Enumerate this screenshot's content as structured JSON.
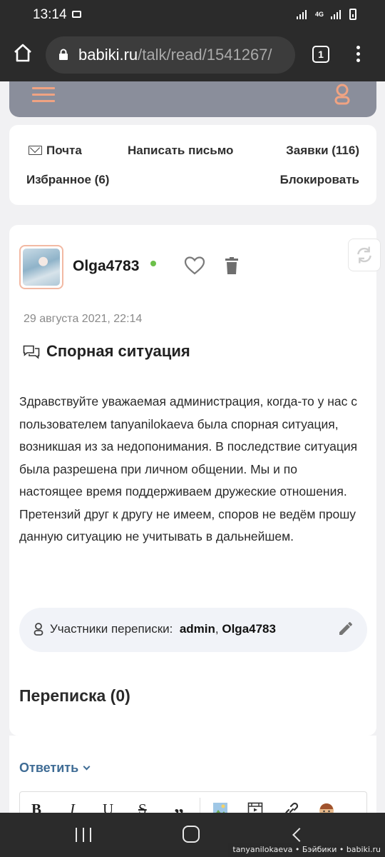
{
  "status_bar": {
    "time": "13:14",
    "network": "4G"
  },
  "browser": {
    "url_host": "babiki.ru",
    "url_path": "/talk/read/1541267/",
    "tab_count": "1"
  },
  "mail_nav": {
    "inbox": "Почта",
    "compose": "Написать письмо",
    "requests": "Заявки (116)",
    "favorites": "Избранное (6)",
    "block": "Блокировать"
  },
  "message": {
    "username": "Olga4783",
    "date": "29 августа 2021, 22:14",
    "subject": "Спорная ситуация",
    "body": "Здравствуйте уважаемая администрация, когда-то у нас с пользователем tanyanilokaeva была спорная ситуация, возникшая из за недопонимания. В последствие ситуация была разрешена при личном общении. Мы и по настоящее время поддерживаем дружеские отношения. Претензий друг к другу не имеем, споров не ведём прошу данную ситуацию не учитывать в дальнейшем.",
    "participants_label": "Участники переписки:",
    "participant_1": "admin",
    "participant_sep": ",",
    "participant_2": "Olga4783",
    "conversation_title": "Переписка (0)"
  },
  "reply": {
    "label": "Ответить",
    "toolbar": {
      "bold": "B",
      "italic": "I",
      "underline": "U",
      "strike": "S",
      "quote": "„"
    }
  },
  "watermark": "tanyanilokaeva • Бэйбики • babiki.ru",
  "colors": {
    "accent_orange": "#f0a382",
    "link_blue": "#3f6c95",
    "online_green": "#6cc04a",
    "nav_gray": "#8a8e9b"
  }
}
